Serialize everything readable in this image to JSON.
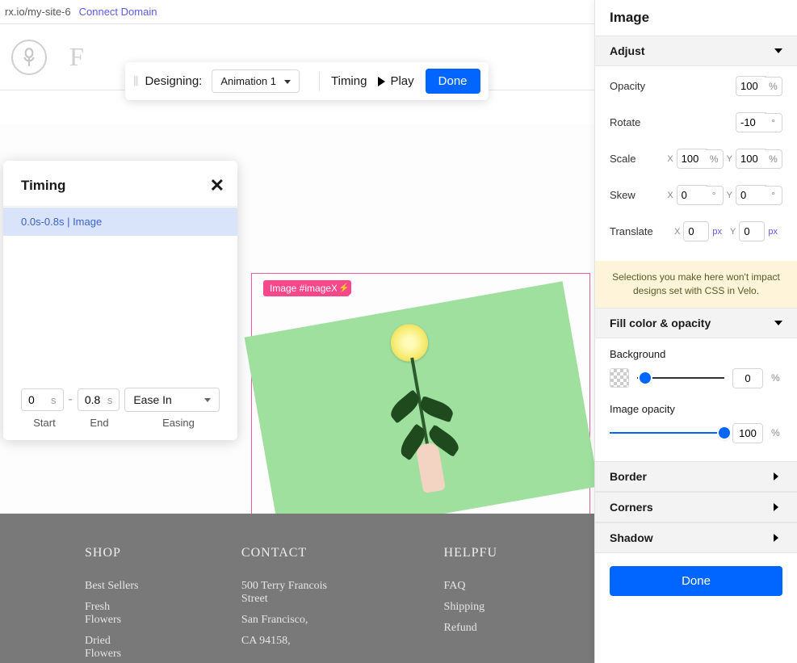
{
  "urlbar": {
    "path": "rx.io/my-site-6",
    "connect": "Connect Domain"
  },
  "toolbar": {
    "designing": "Designing:",
    "animation": "Animation 1",
    "timing": "Timing",
    "play": "Play",
    "done": "Done"
  },
  "timing_panel": {
    "title": "Timing",
    "item": "0.0s-0.8s | Image",
    "start_val": "0",
    "end_val": "0.8",
    "unit": "s",
    "easing": "Ease In",
    "labels": {
      "start": "Start",
      "end": "End",
      "easing": "Easing"
    }
  },
  "canvas": {
    "image_tag": "Image #imageX1",
    "bolt": "⚡"
  },
  "footer": {
    "shop": {
      "h": "SHOP",
      "links": [
        "Best Sellers",
        "Fresh Flowers",
        "Dried Flowers"
      ]
    },
    "contact": {
      "h": "CONTACT",
      "addr1": "500 Terry Francois Street",
      "addr2": "San Francisco,",
      "addr3": "CA 94158,"
    },
    "help": {
      "h": "HELPFU",
      "faq": "FAQ",
      "ship": "Shipping",
      "ref": "Refund "
    }
  },
  "sidebar": {
    "title": "Image",
    "adjust": {
      "h": "Adjust",
      "opacity": {
        "label": "Opacity",
        "val": "100",
        "unit": "%"
      },
      "rotate": {
        "label": "Rotate",
        "val": "-10",
        "unit": "°"
      },
      "scale": {
        "label": "Scale",
        "x": "100",
        "y": "100",
        "unit": "%"
      },
      "skew": {
        "label": "Skew",
        "x": "0",
        "y": "0",
        "unit": "°"
      },
      "translate": {
        "label": "Translate",
        "x": "0",
        "y": "0",
        "unit": "px"
      }
    },
    "warning": "Selections you make here won't impact designs set with CSS in Velo.",
    "fill": {
      "h": "Fill color & opacity",
      "bg_label": "Background",
      "bg_val": "0",
      "bg_pos": "3%",
      "img_label": "Image opacity",
      "img_val": "100",
      "img_pos": "100%"
    },
    "border": {
      "h": "Border"
    },
    "corners": {
      "h": "Corners"
    },
    "shadow": {
      "h": "Shadow"
    },
    "done": "Done",
    "axis": {
      "x": "X",
      "y": "Y"
    }
  }
}
